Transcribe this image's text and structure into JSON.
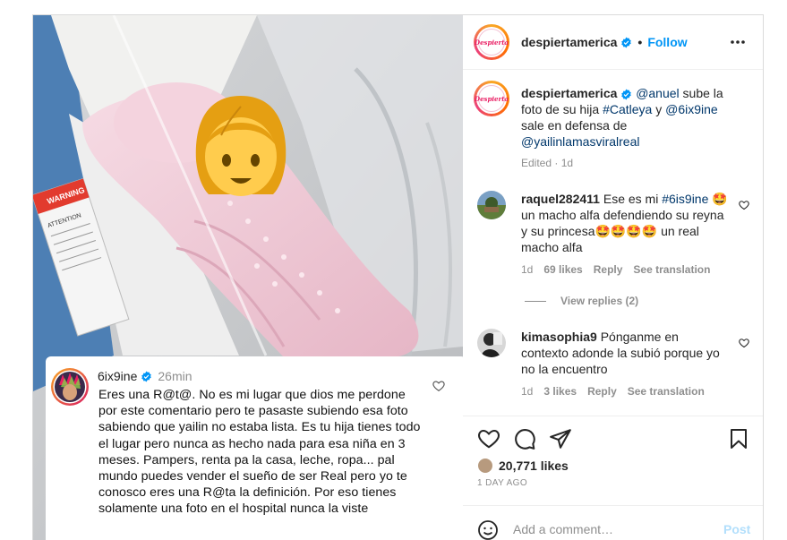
{
  "post": {
    "account": {
      "username": "despiertamerica",
      "follow_label": "Follow",
      "dot": "•",
      "logo_text": "Despierta"
    },
    "caption": {
      "username": "despiertamerica",
      "mention1": "@anuel",
      "text1": " sube la foto de su hija ",
      "hashtag": "#Catleya",
      "text2": " y ",
      "mention2": "@6ix9ine",
      "text3": " sale en defensa de ",
      "mention3": "@yailinlamasviralreal",
      "edited": "Edited · 1d"
    },
    "comments": [
      {
        "username": "raquel282411",
        "text_pre": " Ese es mi ",
        "hashtag": "#6is9ine",
        "text_post": " 🤩 un macho alfa defendiendo su reyna y su princesa🤩🤩🤩🤩 un real macho alfa",
        "time": "1d",
        "likes": "69 likes",
        "reply": "Reply",
        "translate": "See translation",
        "view_replies": "View replies (2)"
      },
      {
        "username": "kimasophia9",
        "text": " Pónganme en contexto adonde la subió porque yo no la encuentro",
        "time": "1d",
        "likes": "3 likes",
        "reply": "Reply",
        "translate": "See translation"
      }
    ],
    "likes_count": "20,771 likes",
    "time_ago": "1 DAY AGO",
    "add_comment_placeholder": "Add a comment…",
    "post_label": "Post"
  },
  "media": {
    "warning_text": "WARNING",
    "attention_text": "ATTENTION",
    "overlay_comment": {
      "username": "6ix9ine",
      "time": "26min",
      "text": "Eres una R@t@. No es mi lugar que dios me perdone por este comentario pero te pasaste subiendo esa foto sabiendo que yailin no estaba lista. Es tu hija tienes todo el lugar pero nunca as hecho nada para esa niña en 3 meses. Pampers, renta pa la casa, leche, ropa... pal mundo puedes vender el sueño de ser Real pero yo te conosco eres una R@ta la definición. Por eso tienes solamente una foto en el hospital nunca la viste"
    }
  },
  "icons": {
    "more": "more-options-icon",
    "like": "heart-icon",
    "comment": "comment-icon",
    "share": "share-icon",
    "save": "bookmark-icon",
    "emoji": "smiley-icon",
    "verified": "verified-badge-icon",
    "face": "girl-emoji-icon"
  },
  "colors": {
    "link": "#00376b",
    "follow": "#0095f6",
    "verified": "#0095f6",
    "muted": "#8e8e8e",
    "emoji_yellow": "#ffcc4d",
    "blanket_pink": "#f0c9d6"
  }
}
